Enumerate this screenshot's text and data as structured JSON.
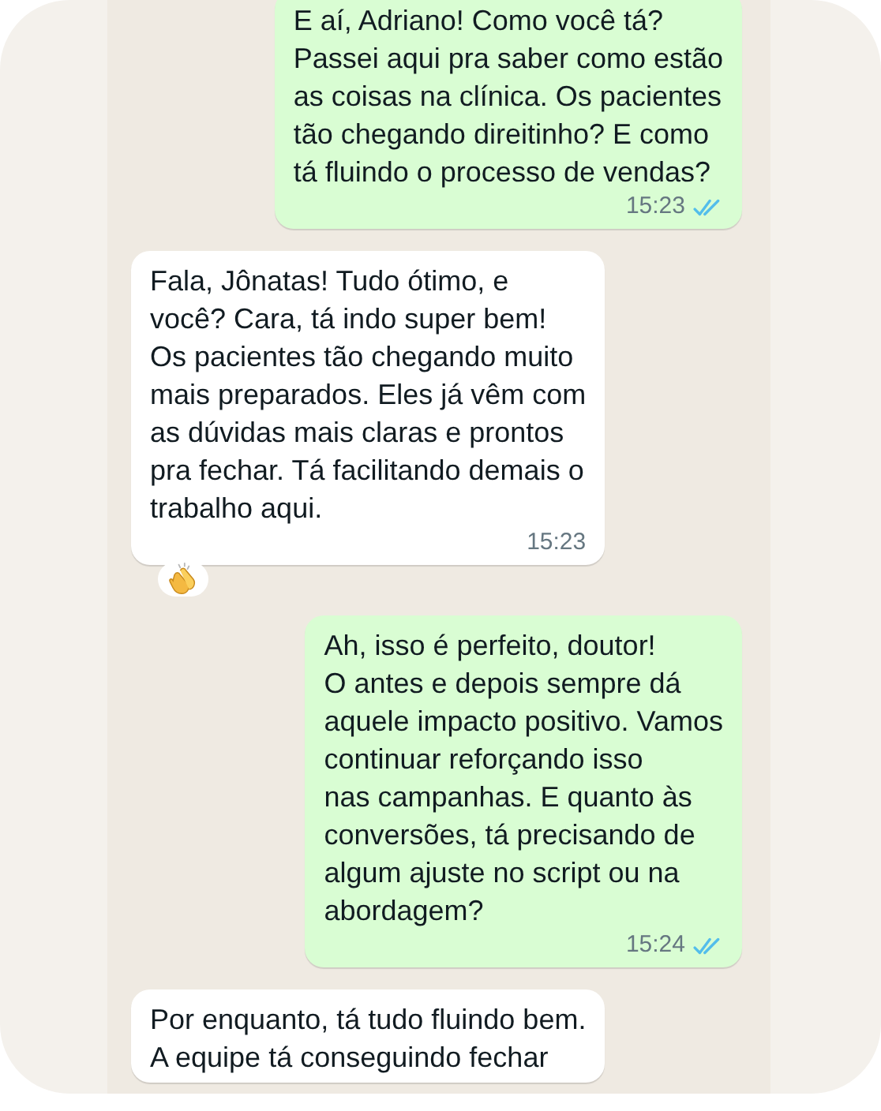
{
  "messages": [
    {
      "kind": "outgoing",
      "text": "E aí, Adriano! Como você tá?\nPassei aqui pra saber como estão\nas coisas na clínica. Os pacientes\ntão chegando direitinho? E como\ntá fluindo o processo de vendas?",
      "time": "15:23",
      "read": true
    },
    {
      "kind": "incoming",
      "text": "Fala, Jônatas! Tudo ótimo, e\nvocê? Cara, tá indo super bem!\nOs pacientes tão chegando muito\nmais preparados. Eles já vêm com\nas dúvidas mais claras e prontos\npra fechar. Tá facilitando demais o\ntrabalho aqui.",
      "time": "15:23",
      "reacted": true
    },
    {
      "kind": "outgoing",
      "text": "Ah, isso é perfeito, doutor!\nO antes e depois sempre dá\naquele impacto positivo. Vamos\ncontinuar reforçando isso\nnas campanhas. E quanto às\nconversões, tá precisando de\nalgum ajuste no script ou na\nabordagem?",
      "time": "15:24",
      "read": true
    },
    {
      "kind": "incoming",
      "text": "Por enquanto, tá tudo fluindo bem.\nA equipe tá conseguindo fechar"
    }
  ]
}
